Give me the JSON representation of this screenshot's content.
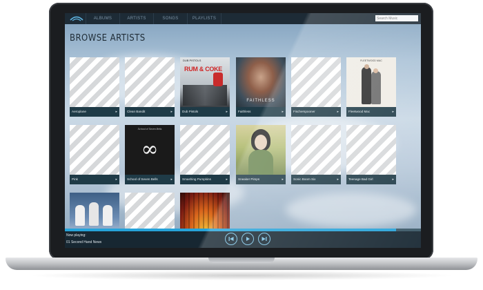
{
  "nav": {
    "items": [
      "ALBUMS",
      "ARTISTS",
      "SONGS",
      "PLAYLISTS"
    ],
    "search_placeholder": "Search Music"
  },
  "page_title": "BROWSE ARTISTS",
  "artists": [
    "Aeroplane",
    "Clean Bandit",
    "Dub Pistols",
    "Faithless",
    "Fischerspooner",
    "Fleetwood Mac",
    "Pink",
    "School of Seven Bells",
    "Smashing Pumpkins",
    "Sneaker Pimps",
    "Sonic Boom Six",
    "Teenage Bad Girl"
  ],
  "album_text": {
    "dub_pistols_top": "DUB PISTOLS",
    "dub_pistols_main": "RUM & COKE",
    "faithless": "FAITHLESS",
    "fleetwood": "FLEETWOOD MAC",
    "school_title": "School of Seven Bells"
  },
  "player": {
    "now_playing_label": "Now playing:",
    "track": "01 Second Hand News",
    "progress_fraction": 0.93
  },
  "colors": {
    "accent": "#26a3d9",
    "label_bar": "#1f3b47",
    "nav_bg": "#1d2b36"
  }
}
